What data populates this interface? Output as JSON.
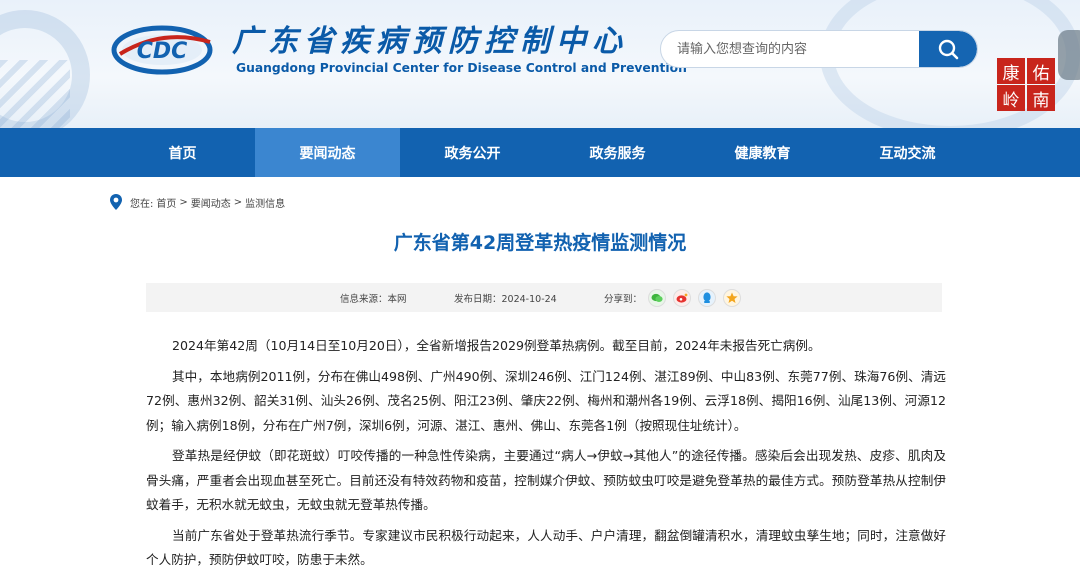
{
  "header": {
    "brand_cn": "广东省疾病预防控制中心",
    "brand_en": "Guangdong Provincial Center for Disease Control and Prevention",
    "logo_text": "CDC",
    "search_placeholder": "请输入您想查询的内容",
    "seal_chars": [
      "康",
      "岭",
      "南",
      "佑"
    ]
  },
  "nav": {
    "items": [
      {
        "label": "首页"
      },
      {
        "label": "要闻动态"
      },
      {
        "label": "政务公开"
      },
      {
        "label": "政务服务"
      },
      {
        "label": "健康教育"
      },
      {
        "label": "互动交流"
      }
    ],
    "active_index": 1
  },
  "breadcrumb": {
    "prefix": "您在:",
    "items": [
      "首页",
      "要闻动态",
      "监测信息"
    ],
    "separator": ">"
  },
  "article": {
    "title": "广东省第42周登革热疫情监测情况",
    "source_label": "信息来源：本网",
    "date_label": "发布日期：2024-10-24",
    "share_label": "分享到：",
    "share_icons": [
      "wechat-icon",
      "weibo-icon",
      "qq-icon",
      "qzone-icon"
    ],
    "paragraphs": [
      "2024年第42周（10月14日至10月20日），全省新增报告2029例登革热病例。截至目前，2024年未报告死亡病例。",
      "其中，本地病例2011例，分布在佛山498例、广州490例、深圳246例、江门124例、湛江89例、中山83例、东莞77例、珠海76例、清远72例、惠州32例、韶关31例、汕头26例、茂名25例、阳江23例、肇庆22例、梅州和潮州各19例、云浮18例、揭阳16例、汕尾13例、河源12例；输入病例18例，分布在广州7例，深圳6例，河源、湛江、惠州、佛山、东莞各1例（按照现住址统计）。",
      "登革热是经伊蚊（即花斑蚊）叮咬传播的一种急性传染病，主要通过“病人→伊蚊→其他人”的途径传播。感染后会出现发热、皮疹、肌肉及骨头痛，严重者会出现血甚至死亡。目前还没有特效药物和疫苗，控制媒介伊蚊、预防蚊虫叮咬是避免登革热的最佳方式。预防登革热从控制伊蚊着手，无积水就无蚊虫，无蚊虫就无登革热传播。",
      "当前广东省处于登革热流行季节。专家建议市民积极行动起来，人人动手、户户清理，翻盆倒罐清积水，清理蚊虫孳生地；同时，注意做好个人防护，预防伊蚊叮咬，防患于未然。"
    ]
  },
  "colors": {
    "primary": "#1262b0",
    "nav_active": "#3b86d0",
    "seal_red": "#c8251c"
  }
}
